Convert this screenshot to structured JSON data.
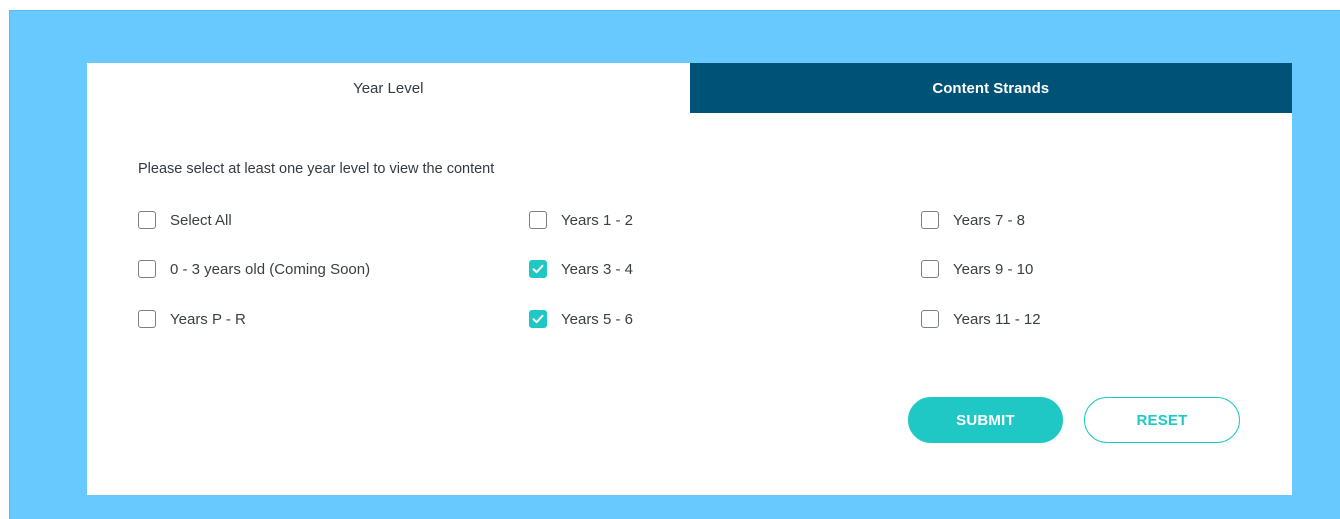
{
  "tabs": [
    {
      "label": "Year Level",
      "active": true
    },
    {
      "label": "Content Strands",
      "active": false
    }
  ],
  "instruction": "Please select at least one year level to view the content",
  "options": [
    {
      "label": "Select All",
      "checked": false
    },
    {
      "label": "0 - 3 years old (Coming Soon)",
      "checked": false
    },
    {
      "label": "Years P - R",
      "checked": false
    },
    {
      "label": "Years 1 - 2",
      "checked": false
    },
    {
      "label": "Years 3 - 4",
      "checked": true
    },
    {
      "label": "Years 5 - 6",
      "checked": true
    },
    {
      "label": "Years 7 - 8",
      "checked": false
    },
    {
      "label": "Years 9 - 10",
      "checked": false
    },
    {
      "label": "Years 11 - 12",
      "checked": false
    }
  ],
  "buttons": {
    "submit_label": "SUBMIT",
    "reset_label": "RESET"
  },
  "colors": {
    "page_background": "#67c9fe",
    "active_tab": "#ffffff",
    "inactive_tab": "#005376",
    "accent": "#1fc8c4"
  },
  "icons": {
    "checked": "checkmark-icon"
  }
}
